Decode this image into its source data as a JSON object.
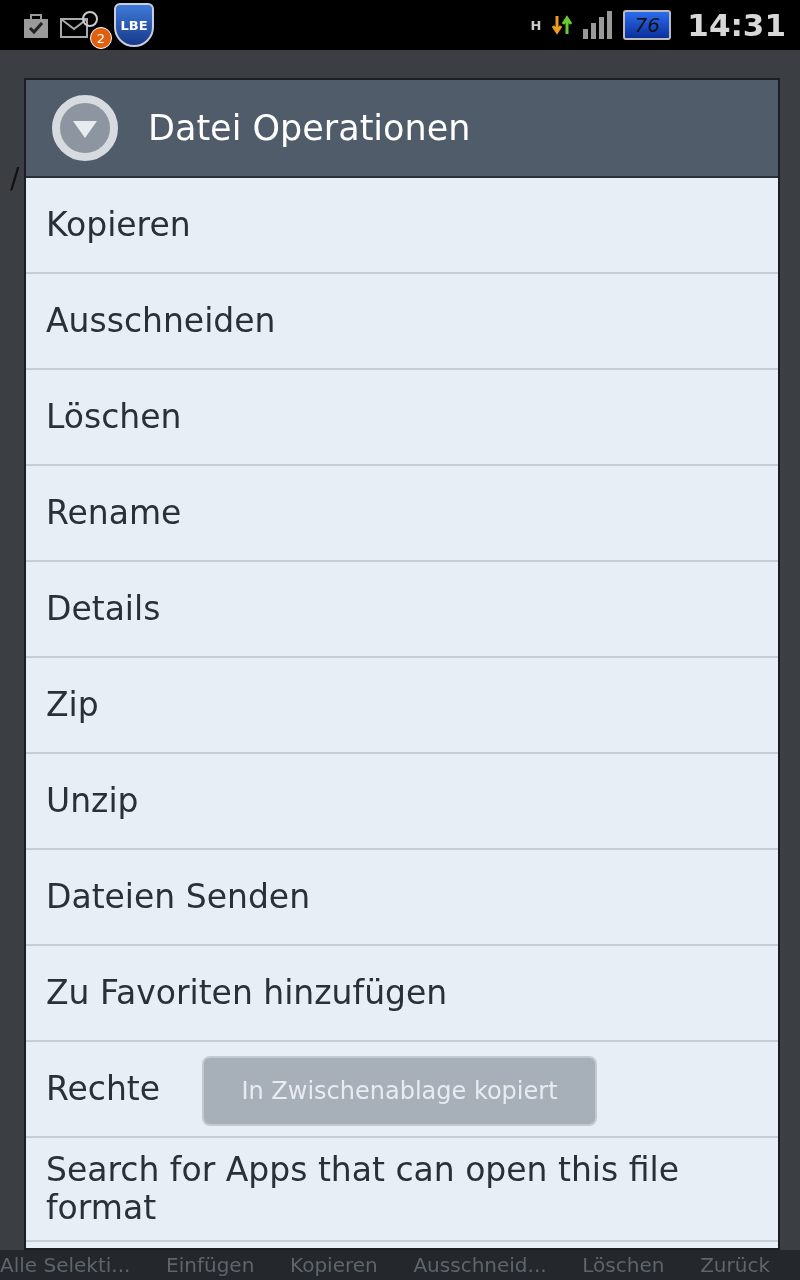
{
  "status_bar": {
    "mail_badge": "2",
    "shield_label": "LBE",
    "network_type": "H",
    "battery": "76",
    "time": "14:31"
  },
  "background": {
    "path": "/"
  },
  "dialog": {
    "title": "Datei Operationen",
    "items": [
      {
        "label": "Kopieren"
      },
      {
        "label": "Ausschneiden"
      },
      {
        "label": "Löschen"
      },
      {
        "label": "Rename"
      },
      {
        "label": "Details"
      },
      {
        "label": "Zip"
      },
      {
        "label": "Unzip"
      },
      {
        "label": "Dateien Senden"
      },
      {
        "label": "Zu Favoriten hinzufügen"
      },
      {
        "label": "Rechte"
      },
      {
        "label": "Search for Apps that can open this file format"
      }
    ]
  },
  "toast": "In Zwischenablage kopiert",
  "bottom_bar": [
    "Alle Selekti...",
    "Einfügen",
    "Kopieren",
    "Ausschneid...",
    "Löschen",
    "Zurück"
  ]
}
